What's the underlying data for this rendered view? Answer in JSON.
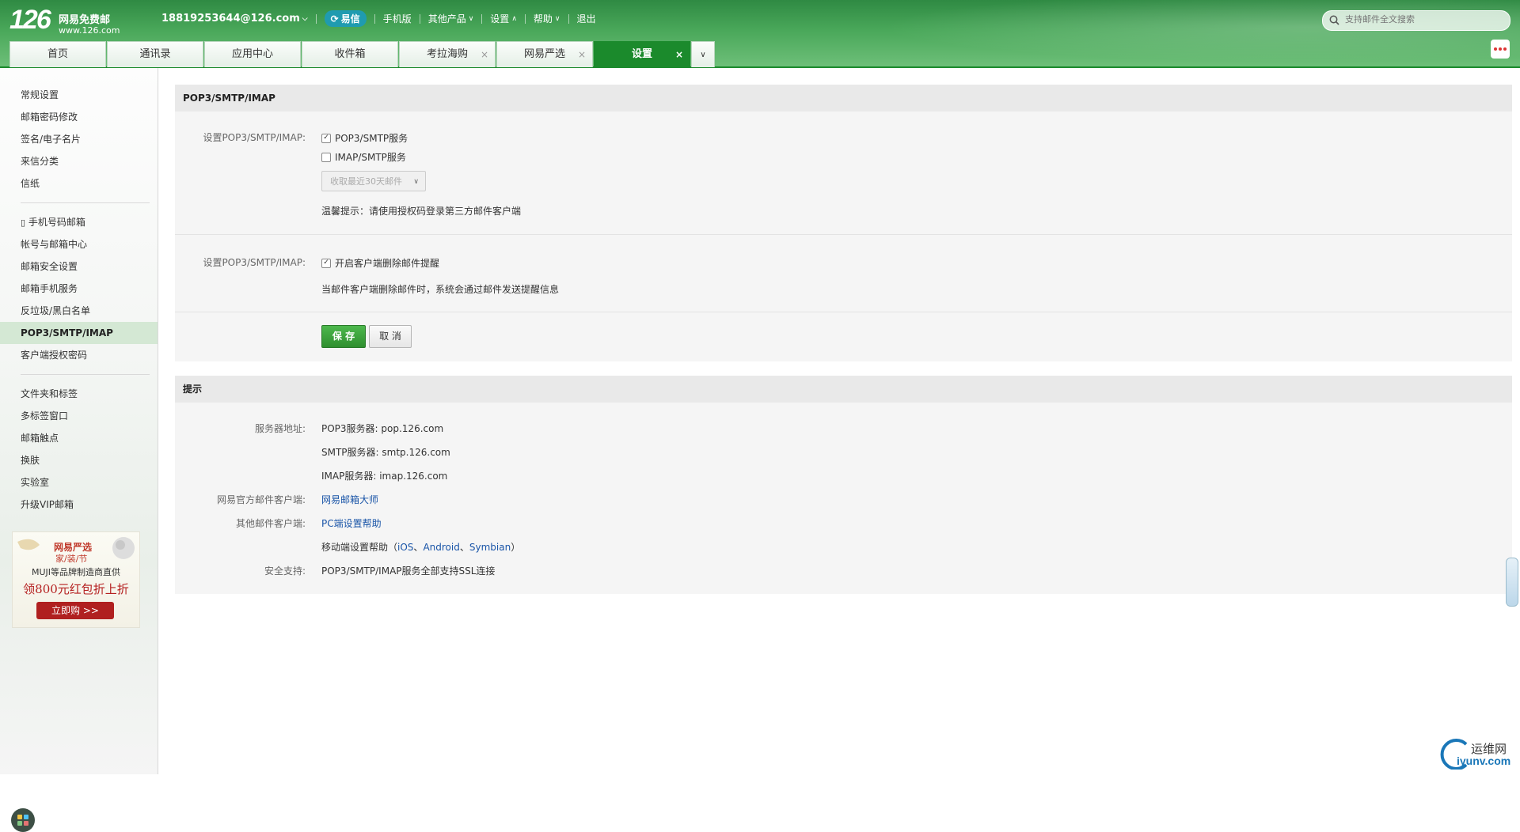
{
  "header": {
    "logo_num": "126",
    "logo_title": "网易免费邮",
    "logo_url": "www.126.com",
    "account": "18819253644@126.com",
    "nav": [
      {
        "label": "易信",
        "caret": false
      },
      {
        "label": "手机版",
        "caret": false
      },
      {
        "label": "其他产品",
        "caret": true
      },
      {
        "label": "设置",
        "caret": true
      },
      {
        "label": "帮助",
        "caret": true
      },
      {
        "label": "退出",
        "caret": false
      }
    ],
    "search_placeholder": "支持邮件全文搜索"
  },
  "tabs": [
    {
      "label": "首页",
      "closable": false,
      "active": false
    },
    {
      "label": "通讯录",
      "closable": false,
      "active": false
    },
    {
      "label": "应用中心",
      "closable": false,
      "active": false
    },
    {
      "label": "收件箱",
      "closable": false,
      "active": false
    },
    {
      "label": "考拉海购",
      "closable": true,
      "active": false
    },
    {
      "label": "网易严选",
      "closable": true,
      "active": false
    },
    {
      "label": "设置",
      "closable": true,
      "active": true
    }
  ],
  "sidebar": {
    "group1": [
      "常规设置",
      "邮箱密码修改",
      "签名/电子名片",
      "来信分类",
      "信纸"
    ],
    "group2": [
      "手机号码邮箱",
      "帐号与邮箱中心",
      "邮箱安全设置",
      "邮箱手机服务",
      "反垃圾/黑白名单",
      "POP3/SMTP/IMAP",
      "客户端授权密码"
    ],
    "group2_active": "POP3/SMTP/IMAP",
    "group3": [
      "文件夹和标签",
      "多标签窗口",
      "邮箱触点",
      "换肤",
      "实验室",
      "升级VIP邮箱"
    ],
    "ad": {
      "brand": "网易严选",
      "sub": "家/装/节",
      "line1": "MUJI等品牌制造商直供",
      "line2": "领800元红包折上折",
      "button": "立即购 >>"
    }
  },
  "settings": {
    "title": "POP3/SMTP/IMAP",
    "label1": "设置POP3/SMTP/IMAP:",
    "pop3_label": "POP3/SMTP服务",
    "pop3_checked": true,
    "imap_label": "IMAP/SMTP服务",
    "imap_checked": false,
    "receive_select": "收取最近30天邮件",
    "tip": "温馨提示：请使用授权码登录第三方邮件客户端",
    "label2": "设置POP3/SMTP/IMAP:",
    "delete_notice_label": "开启客户端删除邮件提醒",
    "delete_notice_checked": true,
    "delete_notice_desc": "当邮件客户端删除邮件时，系统会通过邮件发送提醒信息",
    "save": "保 存",
    "cancel": "取 消"
  },
  "hints": {
    "title": "提示",
    "server_label": "服务器地址:",
    "pop3": "POP3服务器: pop.126.com",
    "smtp": "SMTP服务器: smtp.126.com",
    "imap": "IMAP服务器: imap.126.com",
    "official_label": "网易官方邮件客户端:",
    "official_link": "网易邮箱大师",
    "other_label": "其他邮件客户端:",
    "pc_link": "PC端设置帮助",
    "mobile_prefix": "移动端设置帮助（",
    "ios": "iOS",
    "android": "Android",
    "symbian": "Symbian",
    "dunhao": "、",
    "mobile_suffix": "）",
    "security_label": "安全支持:",
    "security_text": "POP3/SMTP/IMAP服务全部支持SSL连接"
  },
  "watermark": {
    "line1": "运维网",
    "line2": "iyunv.com"
  },
  "colors": {
    "brand_green": "#1b8a2c",
    "link": "#1a55a8",
    "ad_red": "#b02020"
  }
}
